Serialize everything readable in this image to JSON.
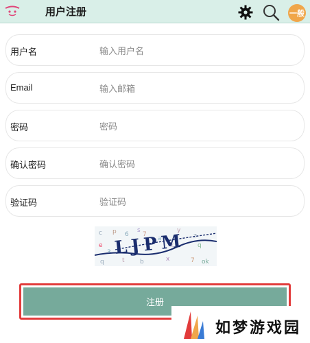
{
  "header": {
    "title": "用户注册",
    "avatar_text": "一般"
  },
  "form": {
    "fields": [
      {
        "label": "用户名",
        "placeholder": "输入用户名"
      },
      {
        "label": "Email",
        "placeholder": "输入邮箱"
      },
      {
        "label": "密码",
        "placeholder": "密码"
      },
      {
        "label": "确认密码",
        "placeholder": "确认密码"
      },
      {
        "label": "验证码",
        "placeholder": "验证码"
      }
    ],
    "register_label": "注册"
  },
  "captcha": {
    "text": "LJPM"
  },
  "watermark": {
    "text": "如梦游戏园"
  },
  "colors": {
    "header_bg": "#d9efe8",
    "button_bg": "#76aa9b",
    "highlight_border": "#e23b3b",
    "avatar_bg": "#f0a64a"
  }
}
